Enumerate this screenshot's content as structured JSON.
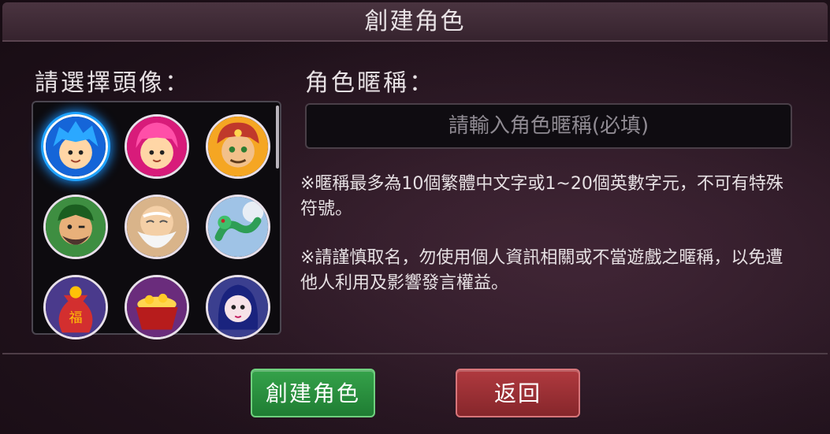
{
  "dialog": {
    "title": "創建角色"
  },
  "avatar_section": {
    "label": "請選擇頭像：",
    "avatars": [
      {
        "name": "blue-hair-boy",
        "selected": true
      },
      {
        "name": "pink-hair-girl",
        "selected": false
      },
      {
        "name": "turban-man",
        "selected": false
      },
      {
        "name": "bearded-warrior",
        "selected": false
      },
      {
        "name": "white-beard-elder",
        "selected": false
      },
      {
        "name": "green-dragon",
        "selected": false
      },
      {
        "name": "fortune-bag",
        "selected": false
      },
      {
        "name": "treasure-bowl",
        "selected": false
      },
      {
        "name": "dark-hair-lady",
        "selected": false
      }
    ]
  },
  "nickname_section": {
    "label": "角色暱稱：",
    "placeholder": "請輸入角色暱稱(必填)",
    "value": ""
  },
  "notes": {
    "rule": "※暱稱最多為10個繁體中文字或1~20個英數字元，不可有特殊符號。",
    "warning": "※請謹慎取名，勿使用個人資訊相關或不當遊戲之暱稱，以免遭他人利用及影響發言權益。"
  },
  "buttons": {
    "create_label": "創建角色",
    "back_label": "返回"
  },
  "colors": {
    "create_button": "#2a9440",
    "back_button": "#9e3136",
    "selected_glow": "#1fa3ff"
  }
}
